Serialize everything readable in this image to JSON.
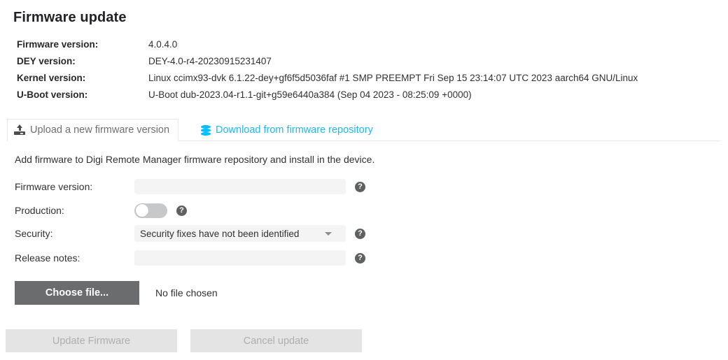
{
  "page": {
    "title": "Firmware update"
  },
  "device_info": {
    "rows": [
      {
        "label": "Firmware version:",
        "value": "4.0.4.0"
      },
      {
        "label": "DEY version:",
        "value": "DEY-4.0-r4-20230915231407"
      },
      {
        "label": "Kernel version:",
        "value": "Linux ccimx93-dvk 6.1.22-dey+gf6f5d5036faf #1 SMP PREEMPT Fri Sep 15 23:14:07 UTC 2023 aarch64 GNU/Linux"
      },
      {
        "label": "U-Boot version:",
        "value": "U-Boot dub-2023.04-r1.1-git+g59e6440a384 (Sep 04 2023 - 08:25:09 +0000)"
      }
    ]
  },
  "tabs": [
    {
      "label": "Upload a new firmware version",
      "icon": "upload-icon",
      "active": true
    },
    {
      "label": "Download from firmware repository",
      "icon": "database-icon",
      "active": false
    }
  ],
  "form": {
    "description": "Add firmware to Digi Remote Manager firmware repository and install in the device.",
    "fields": {
      "firmware_version": {
        "label": "Firmware version:",
        "value": "",
        "placeholder": ""
      },
      "production": {
        "label": "Production:",
        "toggle_state": "off"
      },
      "security": {
        "label": "Security:",
        "selected": "Security fixes have not been identified",
        "options": [
          "Security fixes have not been identified"
        ]
      },
      "release_notes": {
        "label": "Release notes:",
        "value": "",
        "placeholder": ""
      }
    },
    "help_icon_glyph": "?",
    "file_picker": {
      "button_label": "Choose file...",
      "status_text": "No file chosen"
    }
  },
  "actions": {
    "update_firmware": {
      "label": "Update Firmware",
      "disabled": true
    },
    "cancel_update": {
      "label": "Cancel update",
      "disabled": true
    }
  },
  "colors": {
    "link_accent": "#21b6ee",
    "db_icon": "#00bfff",
    "text": "#2f3134",
    "input_bg": "#f4f4f4",
    "button_primary": "#6a6c6e",
    "button_disabled_bg": "#e4e4e4",
    "button_disabled_text": "#adafb1",
    "help_icon_bg": "#5d6164",
    "toggle_track": "#c6c8ca"
  }
}
